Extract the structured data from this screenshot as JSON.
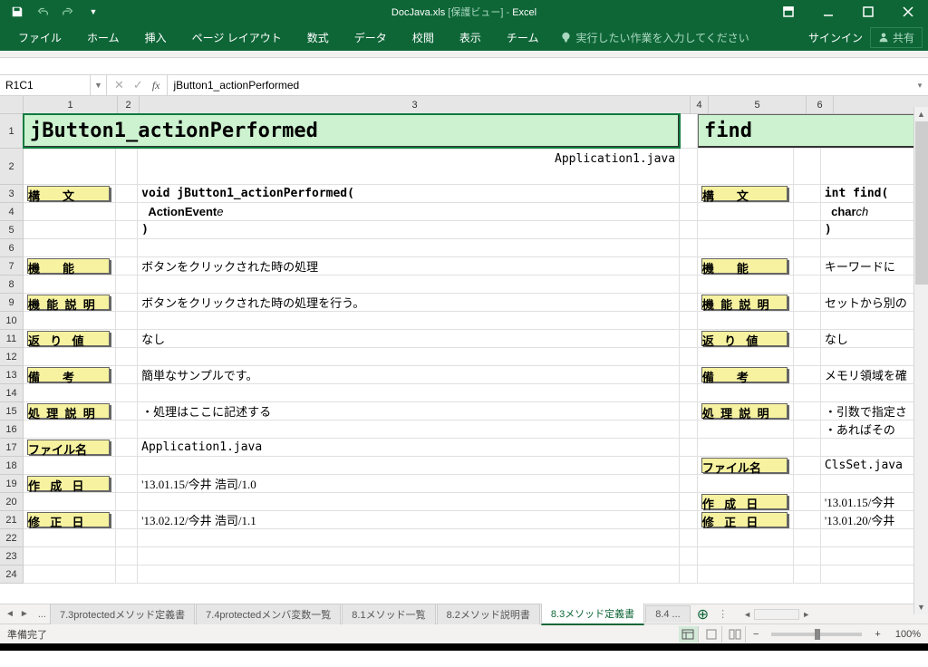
{
  "title": {
    "file": "DocJava.xls",
    "mode": "[保護ビュー]",
    "app": "Excel"
  },
  "qat": {
    "save": "保存",
    "undo": "元に戻す",
    "redo": "やり直し"
  },
  "win": {
    "restore": "",
    "min": "",
    "max": "",
    "close": ""
  },
  "ribbon": {
    "tabs": [
      "ファイル",
      "ホーム",
      "挿入",
      "ページ レイアウト",
      "数式",
      "データ",
      "校閲",
      "表示",
      "チーム"
    ],
    "tellme": "実行したい作業を入力してください",
    "signin": "サインイン",
    "share": "共有"
  },
  "namebox": "R1C1",
  "formula": "jButton1_actionPerformed",
  "cols": [
    "1",
    "2",
    "3",
    "4",
    "5",
    "6"
  ],
  "rows": [
    "1",
    "2",
    "3",
    "4",
    "5",
    "6",
    "7",
    "8",
    "9",
    "10",
    "11",
    "12",
    "13",
    "14",
    "15",
    "16",
    "17",
    "18",
    "19",
    "20",
    "21",
    "22",
    "23",
    "24"
  ],
  "doc1": {
    "title": "jButton1_actionPerformed",
    "file_top": "Application1.java",
    "labels": {
      "syntax": "構　文",
      "func": "機　能",
      "funcdesc": "機 能 説 明",
      "return": "返 り 値",
      "remark": "備　考",
      "procdesc": "処 理 説 明",
      "filename": "ファイル名",
      "created": "作 成 日",
      "updated": "修 正 日"
    },
    "syntax": [
      "void jButton1_actionPerformed(",
      "  ActionEvent e",
      ")"
    ],
    "func": "ボタンをクリックされた時の処理",
    "funcdesc": "ボタンをクリックされた時の処理を行う。",
    "return": "なし",
    "remark": "簡単なサンプルです。",
    "procdesc": "・処理はここに記述する",
    "filename": "Application1.java",
    "created": "'13.01.15/今井 浩司/1.0",
    "updated": "'13.02.12/今井 浩司/1.1"
  },
  "doc2": {
    "title": "find",
    "labels": {
      "syntax": "構　文",
      "func": "機　能",
      "funcdesc": "機 能 説 明",
      "return": "返 り 値",
      "remark": "備　考",
      "procdesc": "処 理 説 明",
      "filename": "ファイル名",
      "created": "作 成 日",
      "updated": "修 正 日"
    },
    "syntax": [
      "int find(",
      "  char ch",
      ")"
    ],
    "func": "キーワードに",
    "funcdesc": "セットから別の",
    "return": "なし",
    "remark": "メモリ領域を確",
    "procdesc1": "・引数で指定さ",
    "procdesc2": "・あればその",
    "filename": "ClsSet.java",
    "created": "'13.01.15/今井",
    "updated": "'13.01.20/今井"
  },
  "sheets": {
    "tabs": [
      "7.3protectedメソッド定義書",
      "7.4protectedメンバ変数一覧",
      "8.1メソッド一覧",
      "8.2メソッド説明書",
      "8.3メソッド定義書",
      "8.4 ..."
    ],
    "active": 4
  },
  "status": {
    "ready": "準備完了",
    "zoom": "100%"
  }
}
